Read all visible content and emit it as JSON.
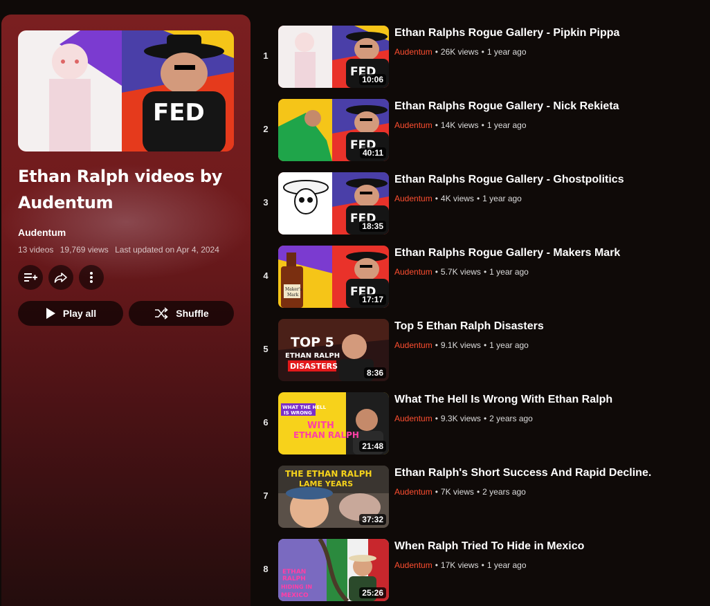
{
  "playlist": {
    "title": "Ethan Ralph videos by Audentum",
    "owner": "Audentum",
    "video_count": "13 videos",
    "view_count": "19,769 views",
    "last_updated": "Last updated on Apr 4, 2024",
    "play_all_label": "Play all",
    "shuffle_label": "Shuffle"
  },
  "videos": [
    {
      "index": "1",
      "title": "Ethan Ralphs Rogue Gallery - Pipkin Pippa",
      "channel": "Audentum",
      "views": "26K views",
      "age": "1 year ago",
      "duration": "10:06"
    },
    {
      "index": "2",
      "title": "Ethan Ralphs Rogue Gallery - Nick Rekieta",
      "channel": "Audentum",
      "views": "14K views",
      "age": "1 year ago",
      "duration": "40:11"
    },
    {
      "index": "3",
      "title": "Ethan Ralphs Rogue Gallery - Ghostpolitics",
      "channel": "Audentum",
      "views": "4K views",
      "age": "1 year ago",
      "duration": "18:35"
    },
    {
      "index": "4",
      "title": "Ethan Ralphs Rogue Gallery - Makers Mark",
      "channel": "Audentum",
      "views": "5.7K views",
      "age": "1 year ago",
      "duration": "17:17"
    },
    {
      "index": "5",
      "title": "Top 5 Ethan Ralph Disasters",
      "channel": "Audentum",
      "views": "9.1K views",
      "age": "1 year ago",
      "duration": "8:36"
    },
    {
      "index": "6",
      "title": "What The Hell Is Wrong With Ethan Ralph",
      "channel": "Audentum",
      "views": "9.3K views",
      "age": "2 years ago",
      "duration": "21:48"
    },
    {
      "index": "7",
      "title": "Ethan Ralph's Short Success And Rapid Decline.",
      "channel": "Audentum",
      "views": "7K views",
      "age": "2 years ago",
      "duration": "37:32"
    },
    {
      "index": "8",
      "title": "When Ralph Tried To Hide in Mexico",
      "channel": "Audentum",
      "views": "17K views",
      "age": "1 year ago",
      "duration": "25:26"
    }
  ],
  "thumb_text": {
    "fed_shirt": "FED",
    "top5": [
      "TOP 5",
      "ETHAN RALPH",
      "DISASTERS"
    ],
    "wth": [
      "WHAT THE HELL",
      "IS WRONG",
      "WITH",
      "ETHAN RALPH"
    ],
    "lame": [
      "THE ETHAN RALPH",
      "LAME YEARS"
    ],
    "mexico": [
      "ETHAN",
      "RALPH",
      "HIDING IN",
      "MEXICO"
    ],
    "makers": [
      "Maker's",
      "Mark"
    ]
  },
  "colors": {
    "channel": "#ff4e30",
    "panel_top": "#7a1f20",
    "background": "#0f0a08"
  }
}
